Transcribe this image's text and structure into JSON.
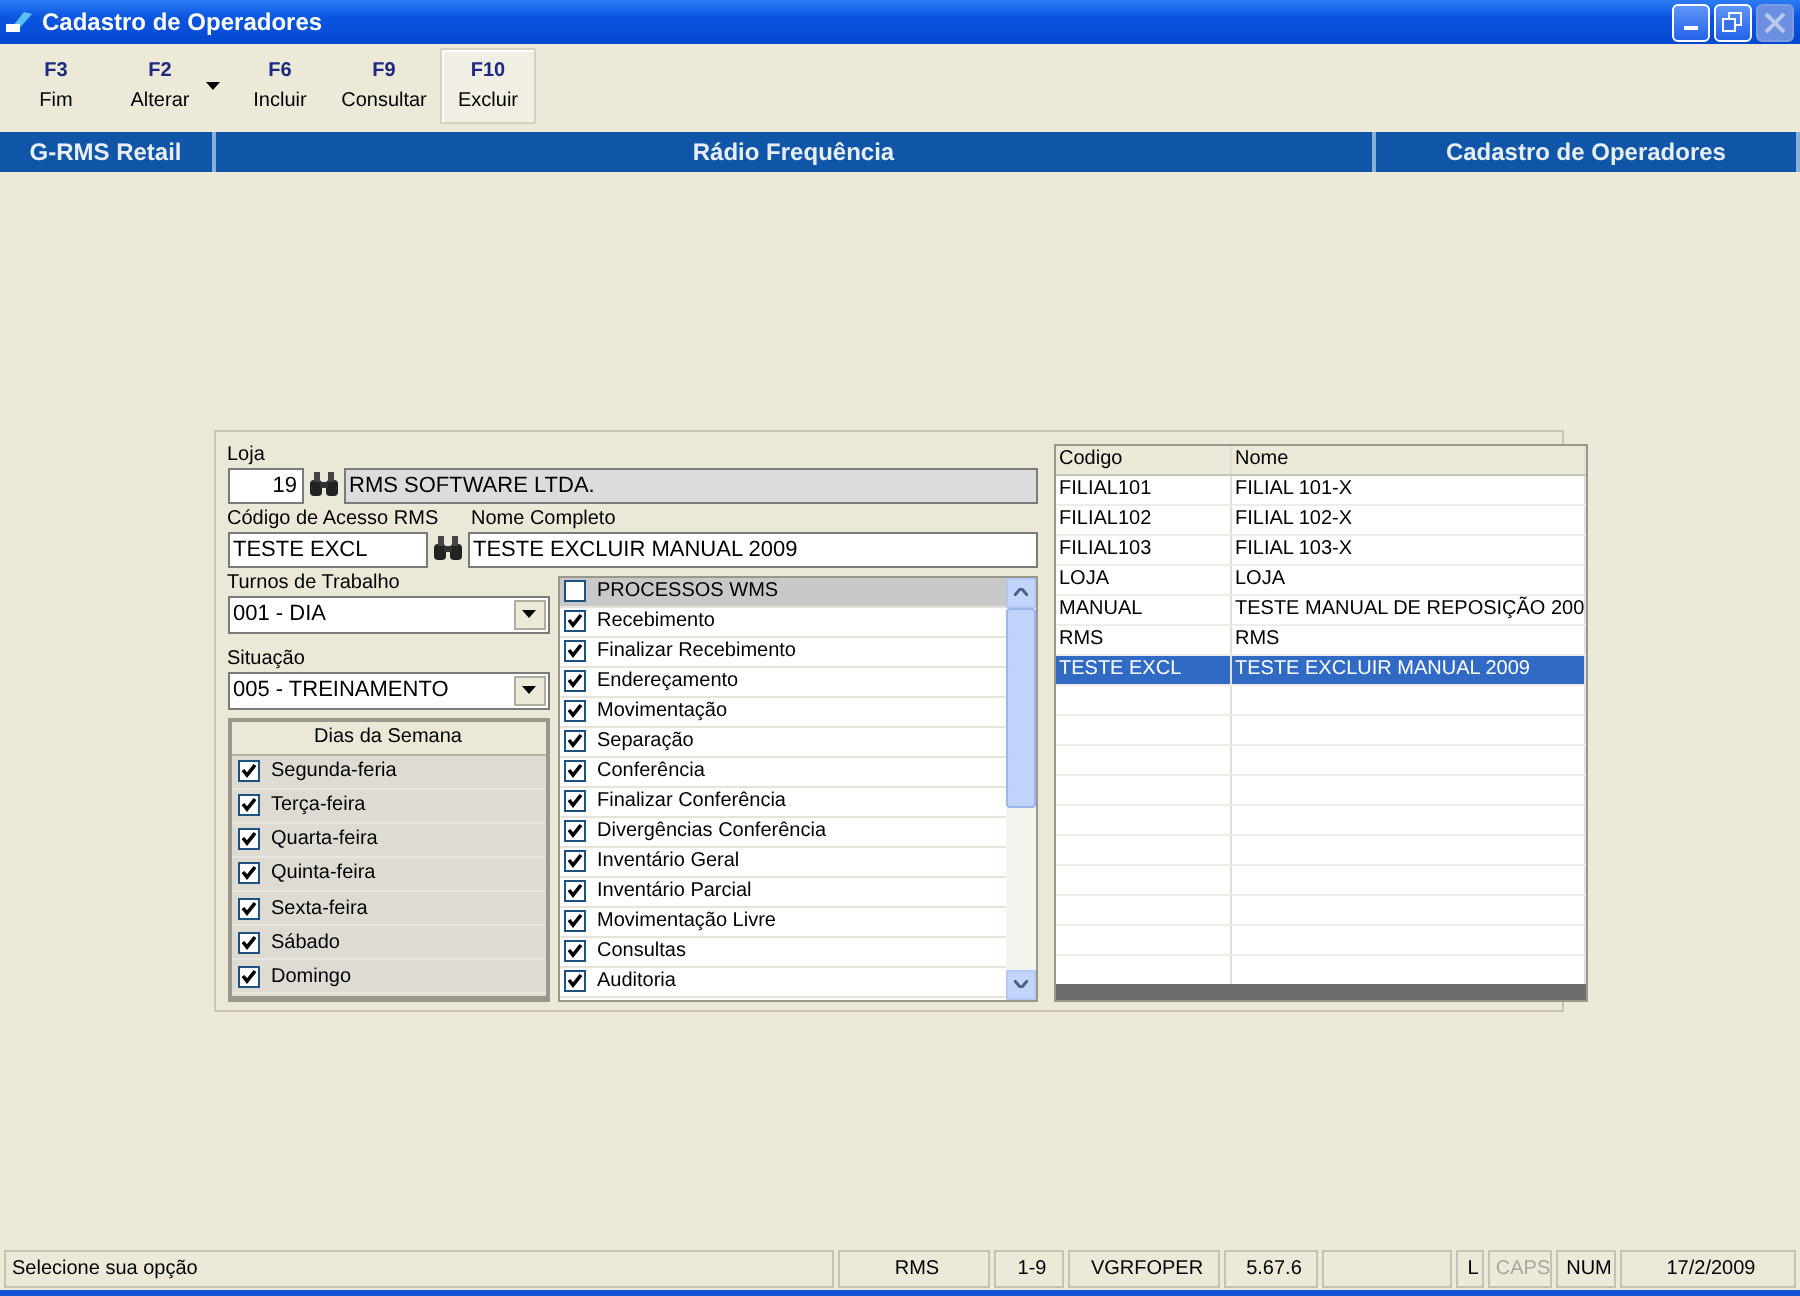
{
  "window": {
    "title": "Cadastro de Operadores",
    "controls": [
      {
        "kind": "minimize",
        "disabled": false
      },
      {
        "kind": "restore",
        "disabled": false
      },
      {
        "kind": "close",
        "disabled": true
      }
    ]
  },
  "toolbar": [
    {
      "key": "F3",
      "label": "Fim",
      "selected": false,
      "has_menu": false
    },
    {
      "key": "F2",
      "label": "Alterar",
      "selected": false,
      "has_menu": true
    },
    {
      "key": "F6",
      "label": "Incluir",
      "selected": false,
      "has_menu": false
    },
    {
      "key": "F9",
      "label": "Consultar",
      "selected": false,
      "has_menu": false
    },
    {
      "key": "F10",
      "label": "Excluir",
      "selected": true,
      "has_menu": false
    }
  ],
  "header": [
    "G-RMS Retail",
    "Rádio Frequência",
    "Cadastro de Operadores"
  ],
  "form": {
    "loja": {
      "label": "Loja",
      "code": "19",
      "name": "RMS SOFTWARE LTDA."
    },
    "acesso": {
      "label": "Código de Acesso RMS",
      "value": "TESTE EXCL"
    },
    "nome": {
      "label": "Nome Completo",
      "value": "TESTE EXCLUIR MANUAL 2009"
    },
    "turnos": {
      "label": "Turnos de Trabalho",
      "value": "001 - DIA"
    },
    "situacao": {
      "label": "Situação",
      "value": "005 - TREINAMENTO"
    },
    "dias": {
      "title": "Dias da Semana",
      "items": [
        {
          "label": "Segunda-feria",
          "checked": true
        },
        {
          "label": "Terça-feira",
          "checked": true
        },
        {
          "label": "Quarta-feira",
          "checked": true
        },
        {
          "label": "Quinta-feira",
          "checked": true
        },
        {
          "label": "Sexta-feira",
          "checked": true
        },
        {
          "label": "Sábado",
          "checked": true
        },
        {
          "label": "Domingo",
          "checked": true
        }
      ]
    },
    "processos": {
      "header": {
        "label": "PROCESSOS WMS",
        "checked": false
      },
      "items": [
        {
          "label": "Recebimento",
          "checked": true
        },
        {
          "label": "Finalizar Recebimento",
          "checked": true
        },
        {
          "label": "Endereçamento",
          "checked": true
        },
        {
          "label": "Movimentação",
          "checked": true
        },
        {
          "label": "Separação",
          "checked": true
        },
        {
          "label": "Conferência",
          "checked": true
        },
        {
          "label": "Finalizar Conferência",
          "checked": true
        },
        {
          "label": "Divergências Conferência",
          "checked": true
        },
        {
          "label": "Inventário Geral",
          "checked": true
        },
        {
          "label": "Inventário Parcial",
          "checked": true
        },
        {
          "label": "Movimentação Livre",
          "checked": true
        },
        {
          "label": "Consultas",
          "checked": true
        },
        {
          "label": "Auditoria",
          "checked": true
        }
      ]
    }
  },
  "grid": {
    "columns": [
      "Codigo",
      "Nome"
    ],
    "rows": [
      {
        "cells": [
          "FILIAL101",
          "FILIAL 101-X"
        ],
        "selected": false
      },
      {
        "cells": [
          "FILIAL102",
          "FILIAL 102-X"
        ],
        "selected": false
      },
      {
        "cells": [
          "FILIAL103",
          "FILIAL 103-X"
        ],
        "selected": false
      },
      {
        "cells": [
          "LOJA",
          "LOJA"
        ],
        "selected": false
      },
      {
        "cells": [
          "MANUAL",
          "TESTE MANUAL DE REPOSIÇÃO 200"
        ],
        "selected": false
      },
      {
        "cells": [
          "RMS",
          "RMS"
        ],
        "selected": false
      },
      {
        "cells": [
          "TESTE EXCL",
          "TESTE EXCLUIR MANUAL 2009"
        ],
        "selected": true
      }
    ]
  },
  "status_bar": [
    {
      "text": "Selecione sua opção",
      "disabled": false
    },
    {
      "text": "RMS",
      "disabled": false
    },
    {
      "text": "1-9",
      "disabled": false
    },
    {
      "text": "VGRFOPER",
      "disabled": false
    },
    {
      "text": "5.67.6",
      "disabled": false
    },
    {
      "text": "L",
      "disabled": false
    },
    {
      "text": "CAPS",
      "disabled": true
    },
    {
      "text": "NUM",
      "disabled": false
    },
    {
      "text": "17/2/2009",
      "disabled": false
    }
  ]
}
